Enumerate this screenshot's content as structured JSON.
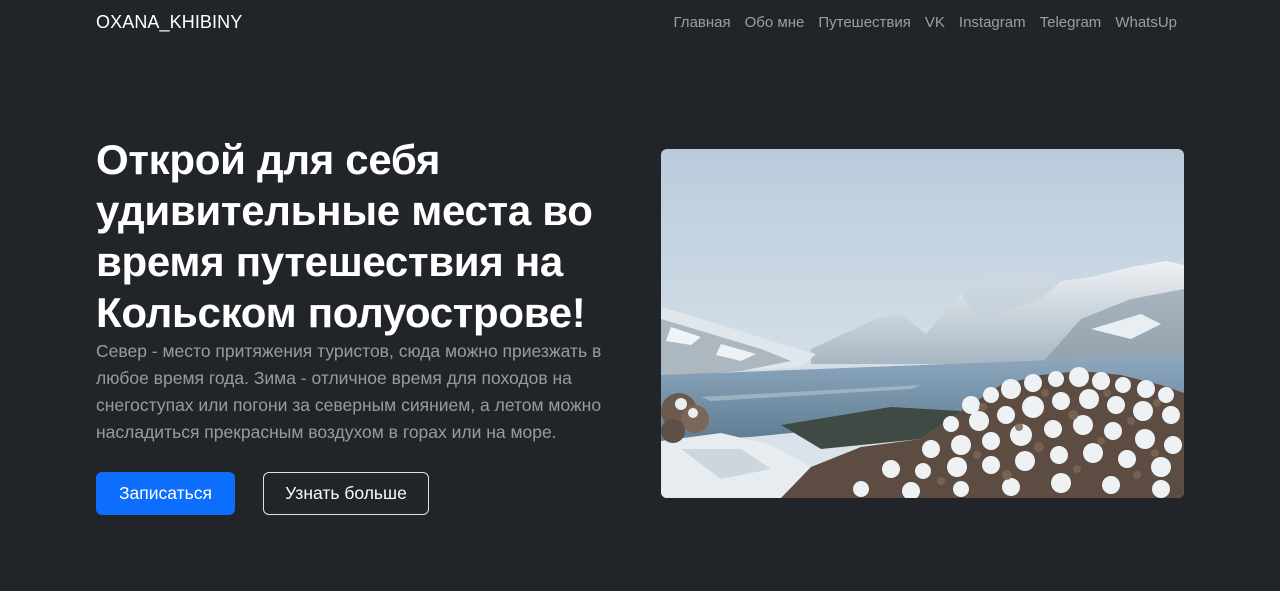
{
  "brand": "OXANA_KHIBINY",
  "nav": {
    "items": [
      {
        "label": "Главная"
      },
      {
        "label": "Обо мне"
      },
      {
        "label": "Путешествия"
      },
      {
        "label": "VK"
      },
      {
        "label": "Instagram"
      },
      {
        "label": "Telegram"
      },
      {
        "label": "WhatsUp"
      }
    ]
  },
  "hero": {
    "title": "Открой для себя удивительные места во время путешествия на Кольском полуострове!",
    "text": "Север - место притяжения туристов, сюда можно приезжать в любое время года. Зима - отличное время для походов на снегоступах или погони за северным сиянием, а летом можно насладиться прекрасным воздухом в горах или на море.",
    "primary_button": "Записаться",
    "secondary_button": "Узнать больше"
  },
  "colors": {
    "background": "#212529",
    "primary": "#0d6efd"
  }
}
